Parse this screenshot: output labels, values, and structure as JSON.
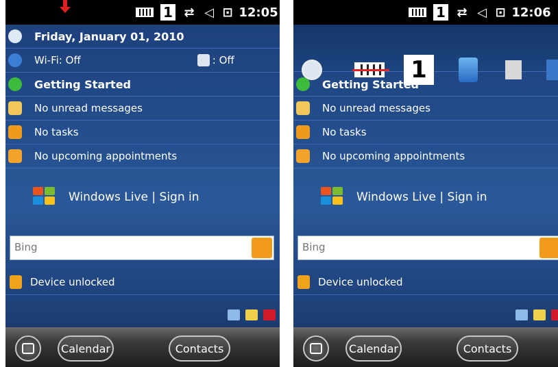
{
  "left": {
    "status": {
      "time": "12:05",
      "profile_number": "1"
    },
    "date": "Friday, January 01, 2010",
    "wifi": "Wi-Fi: Off",
    "bluetooth": ": Off",
    "getting_started": "Getting Started",
    "messages": "No unread messages",
    "tasks": "No tasks",
    "appointments": "No upcoming appointments",
    "windows_live": "Windows Live | Sign in",
    "search_placeholder": "Bing",
    "device_status": "Device unlocked",
    "softkeys": {
      "left": "Calendar",
      "right": "Contacts"
    }
  },
  "right": {
    "status": {
      "time": "12:06",
      "profile_number": "1"
    },
    "quickbar_number": "1",
    "getting_started": "Getting Started",
    "messages": "No unread messages",
    "tasks": "No tasks",
    "appointments": "No upcoming appointments",
    "windows_live": "Windows Live | Sign in",
    "search_placeholder": "Bing",
    "device_status": "Device unlocked",
    "softkeys": {
      "left": "Calendar",
      "right": "Contacts"
    }
  },
  "colors": {
    "accent_orange": "#f29b1a",
    "pointer_red": "#e02020",
    "divider_blue": "#3f6ab5"
  },
  "icons": [
    "clock-icon",
    "wifi-icon",
    "bluetooth-icon",
    "getting-started-icon",
    "mail-icon",
    "tasks-icon",
    "calendar-icon",
    "windows-flag-icon",
    "search-icon",
    "lock-icon",
    "zoom-icon",
    "battery-icon",
    "sync-icon",
    "volume-icon"
  ]
}
